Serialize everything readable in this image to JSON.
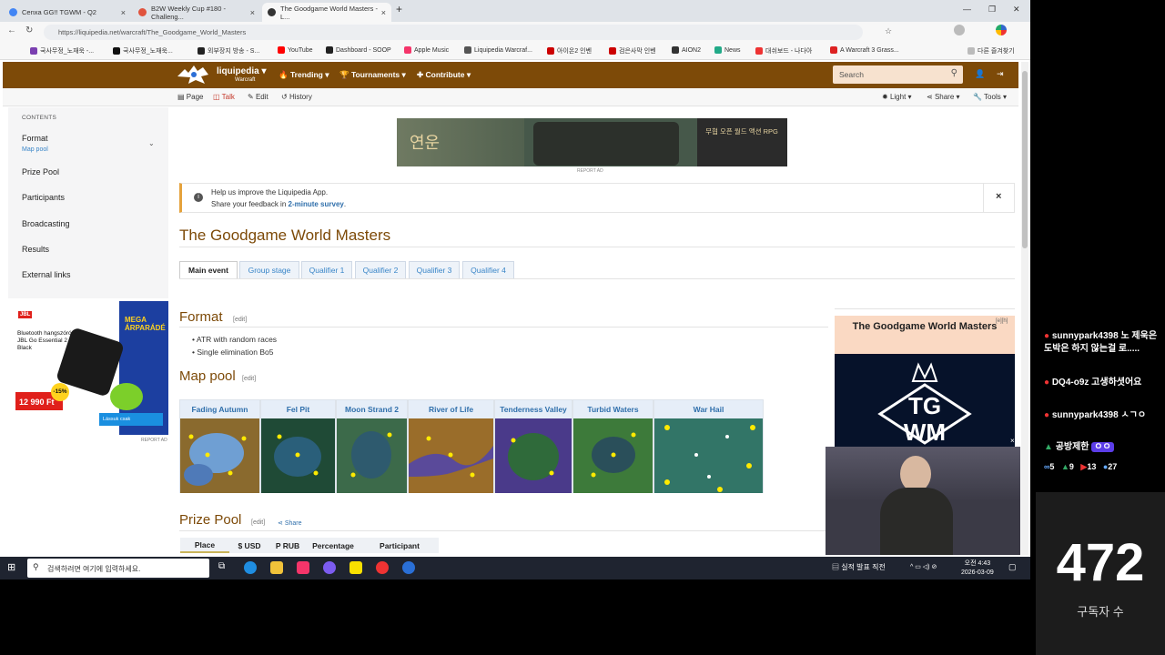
{
  "browser": {
    "tabs": [
      {
        "title": "Cenxa GG!! TGWM - Q2",
        "active": false
      },
      {
        "title": "B2W Weekly Cup #180 - Challeng...",
        "active": false
      },
      {
        "title": "The Goodgame World Masters - L...",
        "active": true
      }
    ],
    "url": "https://liquipedia.net/warcraft/The_Goodgame_World_Masters",
    "bookmarks": [
      "국사무정_노재욱 -...",
      "국사무정_노재욱...",
      "외부장지 방송 - S...",
      "YouTube",
      "Dashboard - SOOP",
      "Apple Music",
      "Liquipedia Warcraf...",
      "아이온2 인벤",
      "검은사막 인벤",
      "AION2",
      "News",
      "대쉬보드 - 나다아",
      "A Warcraft 3 Grass...",
      "다른 즐겨찾기"
    ]
  },
  "wiki": {
    "brand": "liquipedia",
    "brand_sub": "Warcraft",
    "nav": [
      "Trending",
      "Tournaments",
      "Contribute"
    ],
    "search_placeholder": "Search",
    "tools_left": [
      "Page",
      "Talk",
      "Edit",
      "History"
    ],
    "tools_right": [
      "Light",
      "Share",
      "Tools"
    ],
    "contents_title": "CONTENTS",
    "toc": [
      {
        "label": "Format",
        "sub": "Map pool"
      },
      {
        "label": "Prize Pool"
      },
      {
        "label": "Participants"
      },
      {
        "label": "Broadcasting"
      },
      {
        "label": "Results"
      },
      {
        "label": "External links"
      }
    ],
    "side_ad": {
      "brand": "JBL",
      "text": "Bluetooth hangszóró JBL Go Essential 2 Black",
      "price": "12 990 Ft",
      "discount": "-15%",
      "mega": "MEGA ÁRPARÁDÉ",
      "cta": "Lássuk csak",
      "report": "REPORT AD"
    },
    "banner_ad": {
      "left_text": "연운",
      "right_text": "무협 오픈 월드 액션 RPG",
      "report": "REPORT AD"
    },
    "notice": {
      "line1": "Help us improve the Liquipedia App.",
      "line2_prefix": "Share your feedback in ",
      "link": "2-minute survey",
      "line2_suffix": ".",
      "close": "×"
    },
    "title": "The Goodgame World Masters",
    "event_tabs": [
      "Main event",
      "Group stage",
      "Qualifier 1",
      "Qualifier 2",
      "Qualifier 3",
      "Qualifier 4"
    ],
    "format_heading": "Format",
    "edit_label": "[edit]",
    "format_items": [
      "ATR with random races",
      "Single elimination Bo5"
    ],
    "mappool_heading": "Map pool",
    "maps": [
      "Fading Autumn",
      "Fel Pit",
      "Moon Strand 2",
      "River of Life",
      "Tenderness Valley",
      "Turbid Waters",
      "War Hail"
    ],
    "prizepool_heading": "Prize Pool",
    "share_label": "Share",
    "prize_columns": [
      "Place",
      "$ USD",
      "P RUB",
      "Percentage",
      "Participant"
    ],
    "infobox": {
      "title": "The Goodgame World Masters",
      "edit": "[e][h]",
      "logo_top": "TG",
      "logo_bottom": "WM"
    }
  },
  "taskbar": {
    "search_placeholder": "검색하려면 여기에 입력하세요.",
    "news": "실적 발표 직전",
    "time": "오전 4:43",
    "date": "2026-03-09"
  },
  "stream": {
    "chat": [
      {
        "user": "sunnypark4398",
        "text": "노 제욱은 도박은 하지 않는걸 로....."
      },
      {
        "user": "DQ4-o9z",
        "text": "고생하셧어요"
      },
      {
        "user": "sunnypark4398",
        "text": "ㅅㄱㅇ"
      },
      {
        "user": "공방제한",
        "text": "ㅇㅇ"
      }
    ],
    "stats": [
      "5",
      "9",
      "13",
      "27"
    ],
    "subscriber_count": "472",
    "subscriber_label": "구독자 수"
  }
}
